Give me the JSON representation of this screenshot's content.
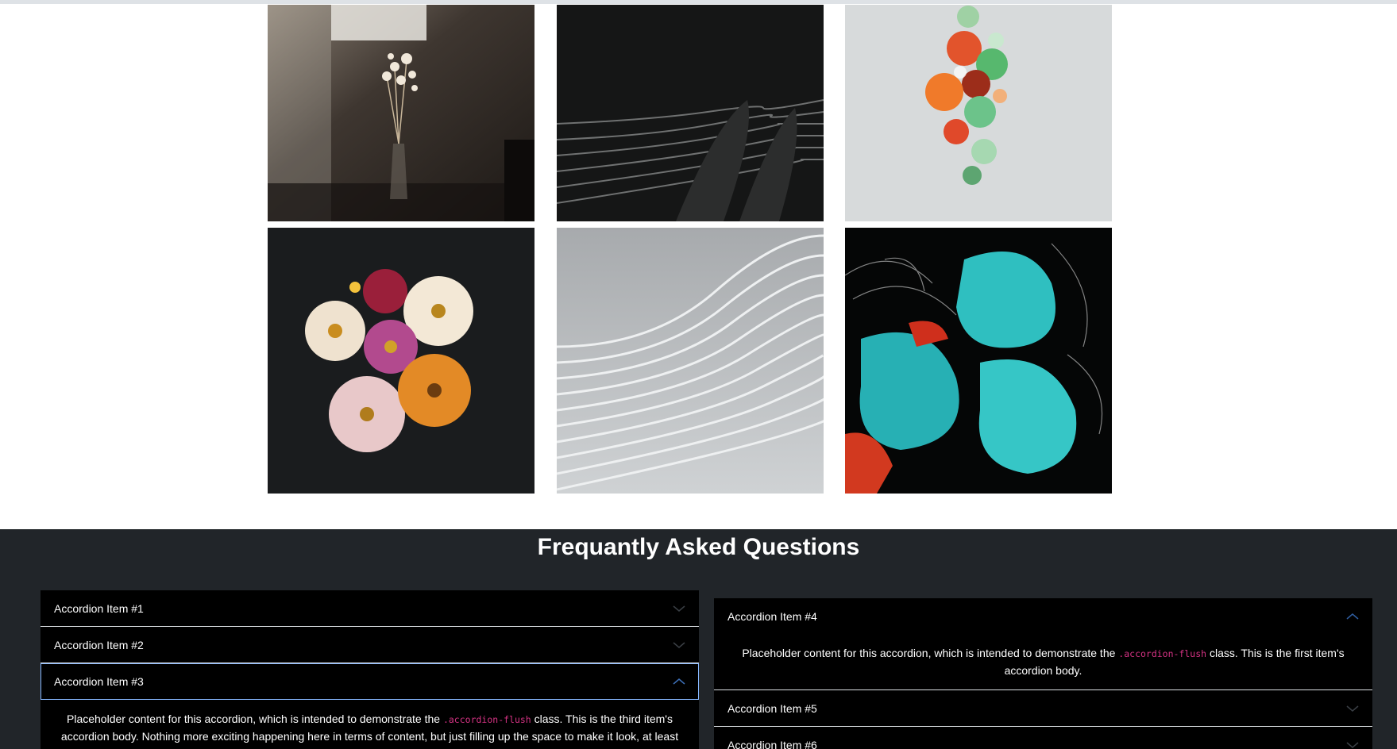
{
  "gallery": {
    "images": [
      {
        "name": "dried-flowers-vase-photo"
      },
      {
        "name": "dark-wave-pattern-photo"
      },
      {
        "name": "colorful-glass-blobs-photo"
      },
      {
        "name": "zinnia-flowers-photo"
      },
      {
        "name": "grey-wave-lines-photo"
      },
      {
        "name": "teal-abstract-shapes-photo"
      }
    ]
  },
  "faq": {
    "title": "Frequantly Asked Questions",
    "left": [
      {
        "label": "Accordion Item #1",
        "expanded": false
      },
      {
        "label": "Accordion Item #2",
        "expanded": false
      },
      {
        "label": "Accordion Item #3",
        "expanded": true,
        "body_pre": "Placeholder content for this accordion, which is intended to demonstrate the ",
        "body_code": ".accordion-flush",
        "body_post": " class. This is the third item's accordion body. Nothing more exciting happening here in terms of content, but just filling up the space to make it look, at least"
      }
    ],
    "right": [
      {
        "label": "Accordion Item #4",
        "expanded": true,
        "body_pre": "Placeholder content for this accordion, which is intended to demonstrate the ",
        "body_code": ".accordion-flush",
        "body_post": " class. This is the first item's accordion body."
      },
      {
        "label": "Accordion Item #5",
        "expanded": false
      },
      {
        "label": "Accordion Item #6",
        "expanded": false
      }
    ]
  },
  "colors": {
    "faq_background": "#212529",
    "accordion_background": "#000000",
    "code_accent": "#d63384",
    "focus_ring": "#86b7fe"
  }
}
